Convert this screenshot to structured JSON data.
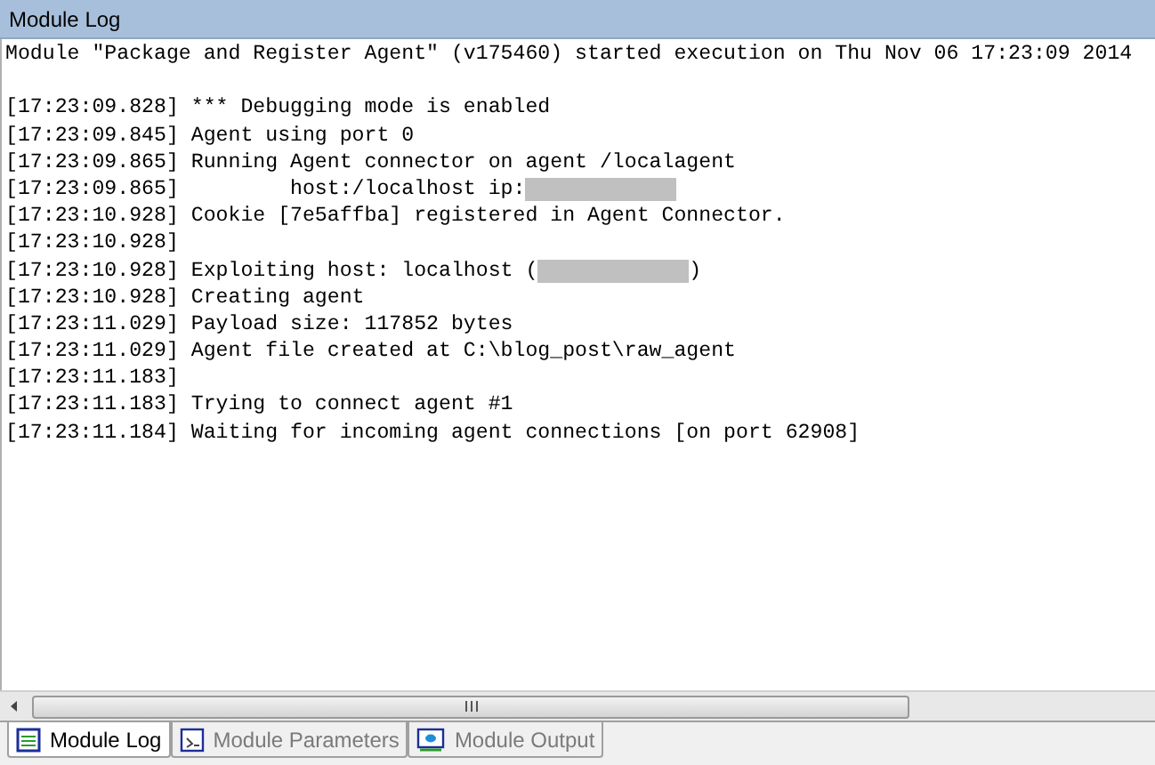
{
  "window": {
    "title": "Module Log"
  },
  "header": "Module \"Package and Register Agent\" (v175460) started execution on Thu Nov 06 17:23:09 2014",
  "lines": [
    {
      "time": "[17:23:09.828]",
      "text": "*** Debugging mode is enabled",
      "redacted": false
    },
    {
      "time": "[17:23:09.845]",
      "text": "Agent using port 0",
      "redacted": false
    },
    {
      "time": "[17:23:09.865]",
      "text": "Running Agent connector on agent /localagent",
      "redacted": false
    },
    {
      "time": "[17:23:09.865]",
      "text": "        host:/localhost ip:",
      "redacted": true
    },
    {
      "time": "[17:23:10.928]",
      "text": "Cookie [7e5affba] registered in Agent Connector.",
      "redacted": false
    },
    {
      "time": "[17:23:10.928]",
      "redacted": false
    },
    {
      "time": "[17:23:10.928]",
      "text": "Exploiting host: localhost (",
      "redacted": true,
      "after": ")"
    },
    {
      "time": "[17:23:10.928]",
      "text": "Creating agent",
      "redacted": false
    },
    {
      "time": "[17:23:11.029]",
      "text": "Payload size: 117852 bytes",
      "redacted": false
    },
    {
      "time": "[17:23:11.029]",
      "text": "Agent file created at C:\\blog_post\\raw_agent",
      "redacted": false
    },
    {
      "time": "[17:23:11.183]",
      "redacted": false
    },
    {
      "time": "[17:23:11.183]",
      "text": "Trying to connect agent #1",
      "redacted": false
    },
    {
      "time": "[17:23:11.184]",
      "text": "Waiting for incoming agent connections [on port 62908]",
      "redacted": false
    }
  ],
  "tabs": [
    {
      "label": "Module Log",
      "selected": true,
      "kind": "log"
    },
    {
      "label": "Module Parameters",
      "selected": false,
      "kind": "params"
    },
    {
      "label": "Module Output",
      "selected": false,
      "kind": "output"
    }
  ]
}
